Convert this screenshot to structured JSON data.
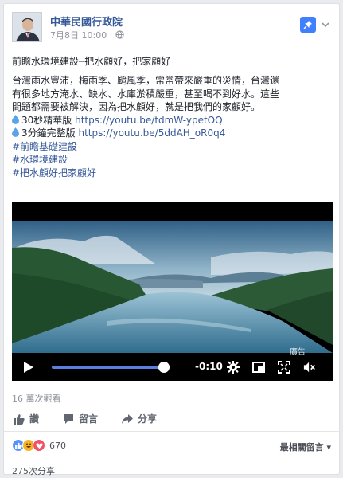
{
  "post": {
    "author": "中華民國行政院",
    "date": "7月8日 10:00",
    "privacy_separator": "·",
    "title_line": "前瞻水環境建設─把水顧好，把家顧好",
    "body_lines": [
      "台灣雨水豐沛，梅雨季、颱風季，常常帶來嚴重的災情，台灣還",
      "有很多地方淹水、缺水、水庫淤積嚴重，甚至喝不到好水。這些",
      "問題都需要被解決，因為把水顧好，就是把我們的家顧好。"
    ],
    "links": [
      {
        "label": "30秒精華版",
        "url": "https://youtu.be/tdmW-ypetOQ"
      },
      {
        "label": "3分鐘完整版",
        "url": "https://youtu.be/5ddAH_oR0q4"
      }
    ],
    "hashtags": [
      "#前瞻基礎建設",
      "#水環境建設",
      "#把水顧好把家顧好"
    ]
  },
  "video": {
    "remaining_time": "-0:10",
    "ad_label": "廣告",
    "progress": 0.95
  },
  "stats": {
    "views": "16 萬次觀看",
    "reaction_count": "670",
    "sort_label": "最相關留言",
    "sort_caret": "▾",
    "shares": "275次分享"
  },
  "actions": {
    "like": "讚",
    "comment": "留言",
    "share": "分享"
  },
  "icons": {
    "pin": "pin-icon",
    "more": "chevron-down-icon",
    "globe": "globe-icon",
    "drop": "water-drop-icon"
  },
  "colors": {
    "link": "#365899",
    "accent": "#4080ff",
    "progress": "#5b7fe0"
  }
}
